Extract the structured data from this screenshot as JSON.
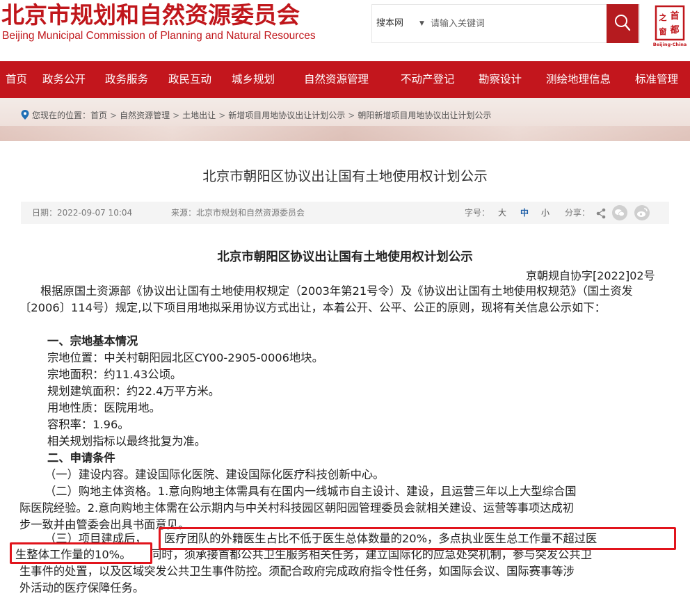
{
  "header": {
    "title_zh": "北京市规划和自然资源委员会",
    "title_en": "Beijing Municipal Commission of Planning and Natural Resources",
    "search_scope": "搜本网",
    "search_placeholder": "请输入关键词",
    "logo_text": "Beijing·China",
    "logo_chars": [
      "首",
      "都",
      "之",
      "窗"
    ]
  },
  "nav": {
    "items": [
      "首页",
      "政务公开",
      "政务服务",
      "政民互动",
      "城乡规划",
      "自然资源管理",
      "不动产登记",
      "勘察设计",
      "测绘地理信息",
      "标准管理"
    ]
  },
  "breadcrumb": {
    "prefix": "您现在的位置：",
    "items": [
      "首页",
      "自然资源管理",
      "土地出让",
      "新增项目用地协议出让计划公示",
      "朝阳新增项目用地协议出让计划公示"
    ],
    "separator": ">"
  },
  "article": {
    "title": "北京市朝阳区协议出让国有土地使用权计划公示",
    "date": "日期：2022-09-07 10:04",
    "source": "来源：北京市规划和自然资源委员会",
    "font_size_label": "字号：",
    "font_sizes": [
      "大",
      "中",
      "小"
    ],
    "share_label": "分享："
  },
  "body": {
    "heading": "北京市朝阳区协议出让国有土地使用权计划公示",
    "doc_no": "京朝规自协字[2022]02号",
    "intro": "根据原国土资源部《协议出让国有土地使用权规定（2003年第21号令）及《协议出让国有土地使用权规范》（国土资发〔2006〕114号）规定,以下项目用地拟采用协议方式出让，本着公开、公平、公正的原则，现将有关信息公示如下：",
    "sec1_title": "一、宗地基本情况",
    "sec1_items": [
      "宗地位置：中关村朝阳园北区CY00-2905-0006地块。",
      "宗地面积：约11.43公顷。",
      "规划建筑面积：约22.4万平方米。",
      "用地性质：医院用地。",
      "容积率：1.96。",
      "相关规划指标以最终批复为准。"
    ],
    "sec2_title": "二、申请条件",
    "cond1": "（一）建设内容。建设国际化医院、建设国际化医疗科技创新中心。",
    "cond2_l1": "（二）购地主体资格。1.意向购地主体需具有在国内一线城市自主设计、建设，且运营三年以上大型综合国",
    "cond2_l2": "际医院经验。2.意向购地主体需在公示期内与中关村科技园区朝阳园管理委员会就相关建设、运营等事项达成初",
    "cond2_l3": "步一致并由管委会出具书面意见。",
    "cond3_lead": "（三）项目建成后，",
    "cond3_hl1": "医疗团队的外籍医生占比不低于医生总体数量的20%，多点执业医生总工作量不超过医",
    "cond3_hl2": "生整体工作量的10%。",
    "cond3_rest1": "同时，须承接首都公共卫生服务相关任务，建立国际化的应急处突机制，参与突发公共卫",
    "cond3_rest2": "生事件的处置，以及区域突发公共卫生事件防控。须配合政府完成政府指令性任务，如国际会议、国际赛事等涉",
    "cond3_rest3": "外活动的医疗保障任务。"
  },
  "colors": {
    "brand_red": "#c3161d",
    "highlight_red": "#e1141c",
    "active_font_size": "#1f5fa8"
  }
}
